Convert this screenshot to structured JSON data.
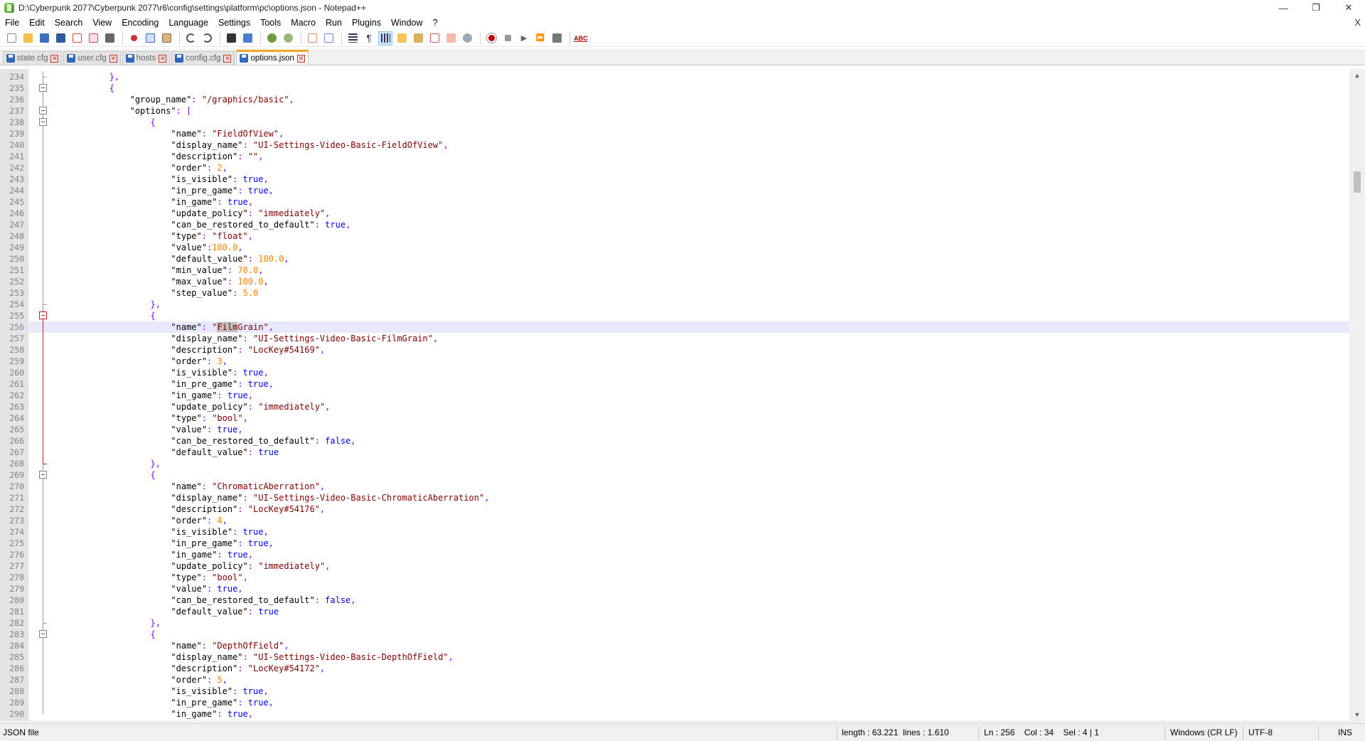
{
  "window": {
    "title": "D:\\Cyberpunk 2077\\Cyberpunk 2077\\r6\\config\\settings\\platform\\pc\\options.json - Notepad++",
    "minimize": "—",
    "maximize": "❐",
    "close": "✕"
  },
  "menu": {
    "items": [
      "File",
      "Edit",
      "Search",
      "View",
      "Encoding",
      "Language",
      "Settings",
      "Tools",
      "Macro",
      "Run",
      "Plugins",
      "Window",
      "?"
    ],
    "close": "X"
  },
  "toolbar": {
    "icons": [
      "new-file",
      "open-file",
      "save",
      "save-all",
      "close",
      "close-all",
      "print",
      "cut",
      "copy",
      "paste",
      "undo",
      "redo",
      "find",
      "replace",
      "zoom-in",
      "zoom-out",
      "sync-vertical",
      "sync-horizontal",
      "word-wrap",
      "show-all-chars",
      "indent-guide",
      "define-language",
      "document-map",
      "function-list",
      "folder-workspace",
      "monitoring",
      "record-macro",
      "stop-recording",
      "playback-macro",
      "run-macro-multiple",
      "save-macro",
      "spell-check"
    ],
    "spellcheck_label": "ABC"
  },
  "tabs": [
    {
      "label": "state.cfg",
      "active": false
    },
    {
      "label": "user.cfg",
      "active": false
    },
    {
      "label": "hosts",
      "active": false
    },
    {
      "label": "config.cfg",
      "active": false
    },
    {
      "label": "options.json",
      "active": true
    }
  ],
  "editor": {
    "first_line": 234,
    "current_line": 256,
    "lines": [
      [
        [
          "            ",
          "t-key"
        ],
        [
          "},",
          "t-punc"
        ]
      ],
      [
        [
          "            ",
          "t-key"
        ],
        [
          "{",
          "t-punc"
        ]
      ],
      [
        [
          "                ",
          "t-key"
        ],
        [
          "\"group_name\"",
          "t-key"
        ],
        [
          ": ",
          "t-punc"
        ],
        [
          "\"/graphics/basic\"",
          "t-str"
        ],
        [
          ",",
          "t-punc"
        ]
      ],
      [
        [
          "                ",
          "t-key"
        ],
        [
          "\"options\"",
          "t-key"
        ],
        [
          ": ",
          "t-punc"
        ],
        [
          "[",
          "t-punc"
        ]
      ],
      [
        [
          "                    ",
          "t-key"
        ],
        [
          "{",
          "t-punc"
        ]
      ],
      [
        [
          "                        ",
          "t-key"
        ],
        [
          "\"name\"",
          "t-key"
        ],
        [
          ": ",
          "t-punc"
        ],
        [
          "\"FieldOfView\"",
          "t-str"
        ],
        [
          ",",
          "t-punc"
        ]
      ],
      [
        [
          "                        ",
          "t-key"
        ],
        [
          "\"display_name\"",
          "t-key"
        ],
        [
          ": ",
          "t-punc"
        ],
        [
          "\"UI-Settings-Video-Basic-FieldOfView\"",
          "t-str"
        ],
        [
          ",",
          "t-punc"
        ]
      ],
      [
        [
          "                        ",
          "t-key"
        ],
        [
          "\"description\"",
          "t-key"
        ],
        [
          ": ",
          "t-punc"
        ],
        [
          "\"\"",
          "t-str"
        ],
        [
          ",",
          "t-punc"
        ]
      ],
      [
        [
          "                        ",
          "t-key"
        ],
        [
          "\"order\"",
          "t-key"
        ],
        [
          ": ",
          "t-punc"
        ],
        [
          "2",
          "t-num"
        ],
        [
          ",",
          "t-punc"
        ]
      ],
      [
        [
          "                        ",
          "t-key"
        ],
        [
          "\"is_visible\"",
          "t-key"
        ],
        [
          ": ",
          "t-punc"
        ],
        [
          "true",
          "t-bool"
        ],
        [
          ",",
          "t-punc"
        ]
      ],
      [
        [
          "                        ",
          "t-key"
        ],
        [
          "\"in_pre_game\"",
          "t-key"
        ],
        [
          ": ",
          "t-punc"
        ],
        [
          "true",
          "t-bool"
        ],
        [
          ",",
          "t-punc"
        ]
      ],
      [
        [
          "                        ",
          "t-key"
        ],
        [
          "\"in_game\"",
          "t-key"
        ],
        [
          ": ",
          "t-punc"
        ],
        [
          "true",
          "t-bool"
        ],
        [
          ",",
          "t-punc"
        ]
      ],
      [
        [
          "                        ",
          "t-key"
        ],
        [
          "\"update_policy\"",
          "t-key"
        ],
        [
          ": ",
          "t-punc"
        ],
        [
          "\"immediately\"",
          "t-str"
        ],
        [
          ",",
          "t-punc"
        ]
      ],
      [
        [
          "                        ",
          "t-key"
        ],
        [
          "\"can_be_restored_to_default\"",
          "t-key"
        ],
        [
          ": ",
          "t-punc"
        ],
        [
          "true",
          "t-bool"
        ],
        [
          ",",
          "t-punc"
        ]
      ],
      [
        [
          "                        ",
          "t-key"
        ],
        [
          "\"type\"",
          "t-key"
        ],
        [
          ": ",
          "t-punc"
        ],
        [
          "\"float\"",
          "t-str"
        ],
        [
          ",",
          "t-punc"
        ]
      ],
      [
        [
          "                        ",
          "t-key"
        ],
        [
          "\"value\"",
          "t-key"
        ],
        [
          ":",
          "t-punc"
        ],
        [
          "100.0",
          "t-num"
        ],
        [
          ",",
          "t-punc"
        ]
      ],
      [
        [
          "                        ",
          "t-key"
        ],
        [
          "\"default_value\"",
          "t-key"
        ],
        [
          ": ",
          "t-punc"
        ],
        [
          "100.0",
          "t-num"
        ],
        [
          ",",
          "t-punc"
        ]
      ],
      [
        [
          "                        ",
          "t-key"
        ],
        [
          "\"min_value\"",
          "t-key"
        ],
        [
          ": ",
          "t-punc"
        ],
        [
          "70.0",
          "t-num"
        ],
        [
          ",",
          "t-punc"
        ]
      ],
      [
        [
          "                        ",
          "t-key"
        ],
        [
          "\"max_value\"",
          "t-key"
        ],
        [
          ": ",
          "t-punc"
        ],
        [
          "100.0",
          "t-num"
        ],
        [
          ",",
          "t-punc"
        ]
      ],
      [
        [
          "                        ",
          "t-key"
        ],
        [
          "\"step_value\"",
          "t-key"
        ],
        [
          ": ",
          "t-punc"
        ],
        [
          "5.0",
          "t-num"
        ]
      ],
      [
        [
          "                    ",
          "t-key"
        ],
        [
          "},",
          "t-punc"
        ]
      ],
      [
        [
          "                    ",
          "t-key"
        ],
        [
          "{",
          "t-punc"
        ]
      ],
      [
        [
          "                        ",
          "t-key"
        ],
        [
          "\"name\"",
          "t-key"
        ],
        [
          ": ",
          "t-punc"
        ],
        [
          "\"",
          "t-str"
        ],
        [
          "Film",
          "t-str sel"
        ],
        [
          "Grain\"",
          "t-str"
        ],
        [
          ",",
          "t-punc"
        ]
      ],
      [
        [
          "                        ",
          "t-key"
        ],
        [
          "\"display_name\"",
          "t-key"
        ],
        [
          ": ",
          "t-punc"
        ],
        [
          "\"UI-Settings-Video-Basic-FilmGrain\"",
          "t-str"
        ],
        [
          ",",
          "t-punc"
        ]
      ],
      [
        [
          "                        ",
          "t-key"
        ],
        [
          "\"description\"",
          "t-key"
        ],
        [
          ": ",
          "t-punc"
        ],
        [
          "\"LocKey#54169\"",
          "t-str"
        ],
        [
          ",",
          "t-punc"
        ]
      ],
      [
        [
          "                        ",
          "t-key"
        ],
        [
          "\"order\"",
          "t-key"
        ],
        [
          ": ",
          "t-punc"
        ],
        [
          "3",
          "t-num"
        ],
        [
          ",",
          "t-punc"
        ]
      ],
      [
        [
          "                        ",
          "t-key"
        ],
        [
          "\"is_visible\"",
          "t-key"
        ],
        [
          ": ",
          "t-punc"
        ],
        [
          "true",
          "t-bool"
        ],
        [
          ",",
          "t-punc"
        ]
      ],
      [
        [
          "                        ",
          "t-key"
        ],
        [
          "\"in_pre_game\"",
          "t-key"
        ],
        [
          ": ",
          "t-punc"
        ],
        [
          "true",
          "t-bool"
        ],
        [
          ",",
          "t-punc"
        ]
      ],
      [
        [
          "                        ",
          "t-key"
        ],
        [
          "\"in_game\"",
          "t-key"
        ],
        [
          ": ",
          "t-punc"
        ],
        [
          "true",
          "t-bool"
        ],
        [
          ",",
          "t-punc"
        ]
      ],
      [
        [
          "                        ",
          "t-key"
        ],
        [
          "\"update_policy\"",
          "t-key"
        ],
        [
          ": ",
          "t-punc"
        ],
        [
          "\"immediately\"",
          "t-str"
        ],
        [
          ",",
          "t-punc"
        ]
      ],
      [
        [
          "                        ",
          "t-key"
        ],
        [
          "\"type\"",
          "t-key"
        ],
        [
          ": ",
          "t-punc"
        ],
        [
          "\"bool\"",
          "t-str"
        ],
        [
          ",",
          "t-punc"
        ]
      ],
      [
        [
          "                        ",
          "t-key"
        ],
        [
          "\"value\"",
          "t-key"
        ],
        [
          ": ",
          "t-punc"
        ],
        [
          "true",
          "t-bool"
        ],
        [
          ",",
          "t-punc"
        ]
      ],
      [
        [
          "                        ",
          "t-key"
        ],
        [
          "\"can_be_restored_to_default\"",
          "t-key"
        ],
        [
          ": ",
          "t-punc"
        ],
        [
          "false",
          "t-bool"
        ],
        [
          ",",
          "t-punc"
        ]
      ],
      [
        [
          "                        ",
          "t-key"
        ],
        [
          "\"default_value\"",
          "t-key"
        ],
        [
          ": ",
          "t-punc"
        ],
        [
          "true",
          "t-bool"
        ]
      ],
      [
        [
          "                    ",
          "t-key"
        ],
        [
          "},",
          "t-punc"
        ]
      ],
      [
        [
          "                    ",
          "t-key"
        ],
        [
          "{",
          "t-punc"
        ]
      ],
      [
        [
          "                        ",
          "t-key"
        ],
        [
          "\"name\"",
          "t-key"
        ],
        [
          ": ",
          "t-punc"
        ],
        [
          "\"ChromaticAberration\"",
          "t-str"
        ],
        [
          ",",
          "t-punc"
        ]
      ],
      [
        [
          "                        ",
          "t-key"
        ],
        [
          "\"display_name\"",
          "t-key"
        ],
        [
          ": ",
          "t-punc"
        ],
        [
          "\"UI-Settings-Video-Basic-ChromaticAberration\"",
          "t-str"
        ],
        [
          ",",
          "t-punc"
        ]
      ],
      [
        [
          "                        ",
          "t-key"
        ],
        [
          "\"description\"",
          "t-key"
        ],
        [
          ": ",
          "t-punc"
        ],
        [
          "\"LocKey#54176\"",
          "t-str"
        ],
        [
          ",",
          "t-punc"
        ]
      ],
      [
        [
          "                        ",
          "t-key"
        ],
        [
          "\"order\"",
          "t-key"
        ],
        [
          ": ",
          "t-punc"
        ],
        [
          "4",
          "t-num"
        ],
        [
          ",",
          "t-punc"
        ]
      ],
      [
        [
          "                        ",
          "t-key"
        ],
        [
          "\"is_visible\"",
          "t-key"
        ],
        [
          ": ",
          "t-punc"
        ],
        [
          "true",
          "t-bool"
        ],
        [
          ",",
          "t-punc"
        ]
      ],
      [
        [
          "                        ",
          "t-key"
        ],
        [
          "\"in_pre_game\"",
          "t-key"
        ],
        [
          ": ",
          "t-punc"
        ],
        [
          "true",
          "t-bool"
        ],
        [
          ",",
          "t-punc"
        ]
      ],
      [
        [
          "                        ",
          "t-key"
        ],
        [
          "\"in_game\"",
          "t-key"
        ],
        [
          ": ",
          "t-punc"
        ],
        [
          "true",
          "t-bool"
        ],
        [
          ",",
          "t-punc"
        ]
      ],
      [
        [
          "                        ",
          "t-key"
        ],
        [
          "\"update_policy\"",
          "t-key"
        ],
        [
          ": ",
          "t-punc"
        ],
        [
          "\"immediately\"",
          "t-str"
        ],
        [
          ",",
          "t-punc"
        ]
      ],
      [
        [
          "                        ",
          "t-key"
        ],
        [
          "\"type\"",
          "t-key"
        ],
        [
          ": ",
          "t-punc"
        ],
        [
          "\"bool\"",
          "t-str"
        ],
        [
          ",",
          "t-punc"
        ]
      ],
      [
        [
          "                        ",
          "t-key"
        ],
        [
          "\"value\"",
          "t-key"
        ],
        [
          ": ",
          "t-punc"
        ],
        [
          "true",
          "t-bool"
        ],
        [
          ",",
          "t-punc"
        ]
      ],
      [
        [
          "                        ",
          "t-key"
        ],
        [
          "\"can_be_restored_to_default\"",
          "t-key"
        ],
        [
          ": ",
          "t-punc"
        ],
        [
          "false",
          "t-bool"
        ],
        [
          ",",
          "t-punc"
        ]
      ],
      [
        [
          "                        ",
          "t-key"
        ],
        [
          "\"default_value\"",
          "t-key"
        ],
        [
          ": ",
          "t-punc"
        ],
        [
          "true",
          "t-bool"
        ]
      ],
      [
        [
          "                    ",
          "t-key"
        ],
        [
          "},",
          "t-punc"
        ]
      ],
      [
        [
          "                    ",
          "t-key"
        ],
        [
          "{",
          "t-punc"
        ]
      ],
      [
        [
          "                        ",
          "t-key"
        ],
        [
          "\"name\"",
          "t-key"
        ],
        [
          ": ",
          "t-punc"
        ],
        [
          "\"DepthOfField\"",
          "t-str"
        ],
        [
          ",",
          "t-punc"
        ]
      ],
      [
        [
          "                        ",
          "t-key"
        ],
        [
          "\"display_name\"",
          "t-key"
        ],
        [
          ": ",
          "t-punc"
        ],
        [
          "\"UI-Settings-Video-Basic-DepthOfField\"",
          "t-str"
        ],
        [
          ",",
          "t-punc"
        ]
      ],
      [
        [
          "                        ",
          "t-key"
        ],
        [
          "\"description\"",
          "t-key"
        ],
        [
          ": ",
          "t-punc"
        ],
        [
          "\"LocKey#54172\"",
          "t-str"
        ],
        [
          ",",
          "t-punc"
        ]
      ],
      [
        [
          "                        ",
          "t-key"
        ],
        [
          "\"order\"",
          "t-key"
        ],
        [
          ": ",
          "t-punc"
        ],
        [
          "5",
          "t-num"
        ],
        [
          ",",
          "t-punc"
        ]
      ],
      [
        [
          "                        ",
          "t-key"
        ],
        [
          "\"is_visible\"",
          "t-key"
        ],
        [
          ": ",
          "t-punc"
        ],
        [
          "true",
          "t-bool"
        ],
        [
          ",",
          "t-punc"
        ]
      ],
      [
        [
          "                        ",
          "t-key"
        ],
        [
          "\"in_pre_game\"",
          "t-key"
        ],
        [
          ": ",
          "t-punc"
        ],
        [
          "true",
          "t-bool"
        ],
        [
          ",",
          "t-punc"
        ]
      ],
      [
        [
          "                        ",
          "t-key"
        ],
        [
          "\"in_game\"",
          "t-key"
        ],
        [
          ": ",
          "t-punc"
        ],
        [
          "true",
          "t-bool"
        ],
        [
          ",",
          "t-punc"
        ]
      ]
    ]
  },
  "status": {
    "file_type": "JSON file",
    "length": "length : 63.221",
    "lines": "lines : 1.610",
    "position": "Ln : 256    Col : 34    Sel : 4 | 1",
    "eol": "Windows (CR LF)",
    "encoding": "UTF-8",
    "mode": "INS"
  },
  "colors": {
    "string": "#800000",
    "number": "#ff8000",
    "boolean": "#0000ff",
    "punctuation": "#8000ff",
    "current_line": "#e8e8ff",
    "active_tab_accent": "#f5a623"
  }
}
